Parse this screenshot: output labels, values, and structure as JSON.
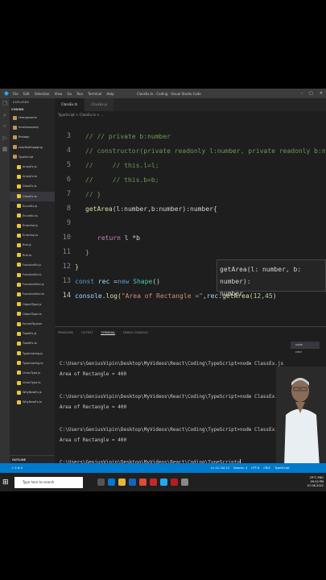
{
  "window": {
    "title": "ClassEx.ts - Coding - Visual Studio Code",
    "menu": [
      "File",
      "Edit",
      "Selection",
      "View",
      "Go",
      "Run",
      "Terminal",
      "Help"
    ]
  },
  "explorer": {
    "header": "EXPLORER",
    "root": "CODING",
    "items": [
      {
        "label": "changename",
        "type": "folder"
      },
      {
        "label": "errorboundary",
        "type": "folder"
      },
      {
        "label": "firstapp",
        "type": "folder"
      },
      {
        "label": "reacttwithpaging",
        "type": "folder"
      },
      {
        "label": "TypeScript",
        "type": "folder"
      },
      {
        "label": "ArrayEx.js",
        "type": "file"
      },
      {
        "label": "ArrayEx.ts",
        "type": "file"
      },
      {
        "label": "ClassEx.js",
        "type": "file"
      },
      {
        "label": "ClassEx.ts",
        "type": "file",
        "selected": true
      },
      {
        "label": "EnumEx.js",
        "type": "file"
      },
      {
        "label": "EnumEx.ts",
        "type": "file"
      },
      {
        "label": "ErrorUse.js",
        "type": "file"
      },
      {
        "label": "ErrorUse.ts",
        "type": "file"
      },
      {
        "label": "first.js",
        "type": "file"
      },
      {
        "label": "first.ts",
        "type": "file"
      },
      {
        "label": "FunctionEx.js",
        "type": "file"
      },
      {
        "label": "FunctionEx.ts",
        "type": "file"
      },
      {
        "label": "FunctionDecl.js",
        "type": "file"
      },
      {
        "label": "FunctionDecl.ts",
        "type": "file"
      },
      {
        "label": "ObjectType.js",
        "type": "file"
      },
      {
        "label": "ObjectType.ts",
        "type": "file"
      },
      {
        "label": "tscconfig.json",
        "type": "file"
      },
      {
        "label": "TupleEx.js",
        "type": "file"
      },
      {
        "label": "TupleEx.ts",
        "type": "file"
      },
      {
        "label": "TypeCasting.js",
        "type": "file"
      },
      {
        "label": "TypeCasting.ts",
        "type": "file"
      },
      {
        "label": "UnionType.js",
        "type": "file"
      },
      {
        "label": "UnionType.ts",
        "type": "file"
      },
      {
        "label": "WhyNewEx.js",
        "type": "file"
      },
      {
        "label": "WhyNewEx.ts",
        "type": "file"
      }
    ],
    "outline": "OUTLINE",
    "timeline": "TIMELINE"
  },
  "tabs": [
    {
      "label": "ClassEx.ts",
      "active": true
    },
    {
      "label": "ClassEx.js",
      "active": false
    }
  ],
  "breadcrumb": "TypeScript > ClassEx.ts > ...",
  "editor": {
    "line_numbers": [
      "3",
      "4",
      "5",
      "6",
      "7",
      "8",
      "9",
      "10",
      "11",
      "12",
      "13",
      "14"
    ],
    "current_line": "14",
    "lines": {
      "l3": "// // private b:number",
      "l4": "// constructor(private readonly l:number, private readonly b:number){",
      "l5": "//     // this.l=l;",
      "l6": "//     // this.b=b;",
      "l7": "// }",
      "l8_fn": "getArea",
      "l8_rest": "(l:number,b:number):number{",
      "l10_ret": "return",
      "l10_rest": " l *b",
      "l11": "}",
      "l12": "}",
      "l13_const": "const",
      "l13_var": " rec",
      "l13_eq": " =",
      "l13_new": "new",
      "l13_cls": " Shape",
      "l13_paren": "()",
      "l14_console": "console",
      "l14_log": ".log(",
      "l14_str": "\"Area of Rectangle =\"",
      "l14_comma": ",",
      "l14_rec": "rec",
      "l14_get": ".getArea(",
      "l14_args": "12,45",
      "l14_close": ")"
    }
  },
  "hover": {
    "line1": "getArea(l: number, b: number):",
    "line2": "number"
  },
  "panel": {
    "tabs": [
      "PROBLEMS",
      "OUTPUT",
      "TERMINAL",
      "DEBUG CONSOLE"
    ],
    "active_tab": "TERMINAL",
    "terminal_list": [
      "node",
      "cmd"
    ],
    "terminal_lines": [
      "C:\\Users\\GeniusVipin\\Desktop\\MyVideos\\React\\Coding\\TypeScript>node ClassEx.js",
      "Area of Rectangle = 400",
      "C:\\Users\\GeniusVipin\\Desktop\\MyVideos\\React\\Coding\\TypeScript>node ClassEx.js",
      "Area of Rectangle = 400",
      "C:\\Users\\GeniusVipin\\Desktop\\MyVideos\\React\\Coding\\TypeScript>node ClassEx.js",
      "Area of Rectangle = 400",
      "C:\\Users\\GeniusVipin\\Desktop\\MyVideos\\React\\Coding\\TypeScript>"
    ]
  },
  "statusbar": {
    "left": "⚠ 0  ⊗ 0",
    "position": "Ln 14, Col 12",
    "spaces": "Spaces: 4",
    "encoding": "UTF-8",
    "eol": "CRLF",
    "lang": "TypeScript"
  },
  "taskbar": {
    "search_placeholder": "Type here to search",
    "weather": "29°C",
    "lang": "ENG",
    "time": "09:20 PM",
    "date": "07-08-2022"
  },
  "colors": {
    "accent": "#007acc",
    "editor_bg": "#1e1e1e",
    "sidebar_bg": "#252526"
  }
}
